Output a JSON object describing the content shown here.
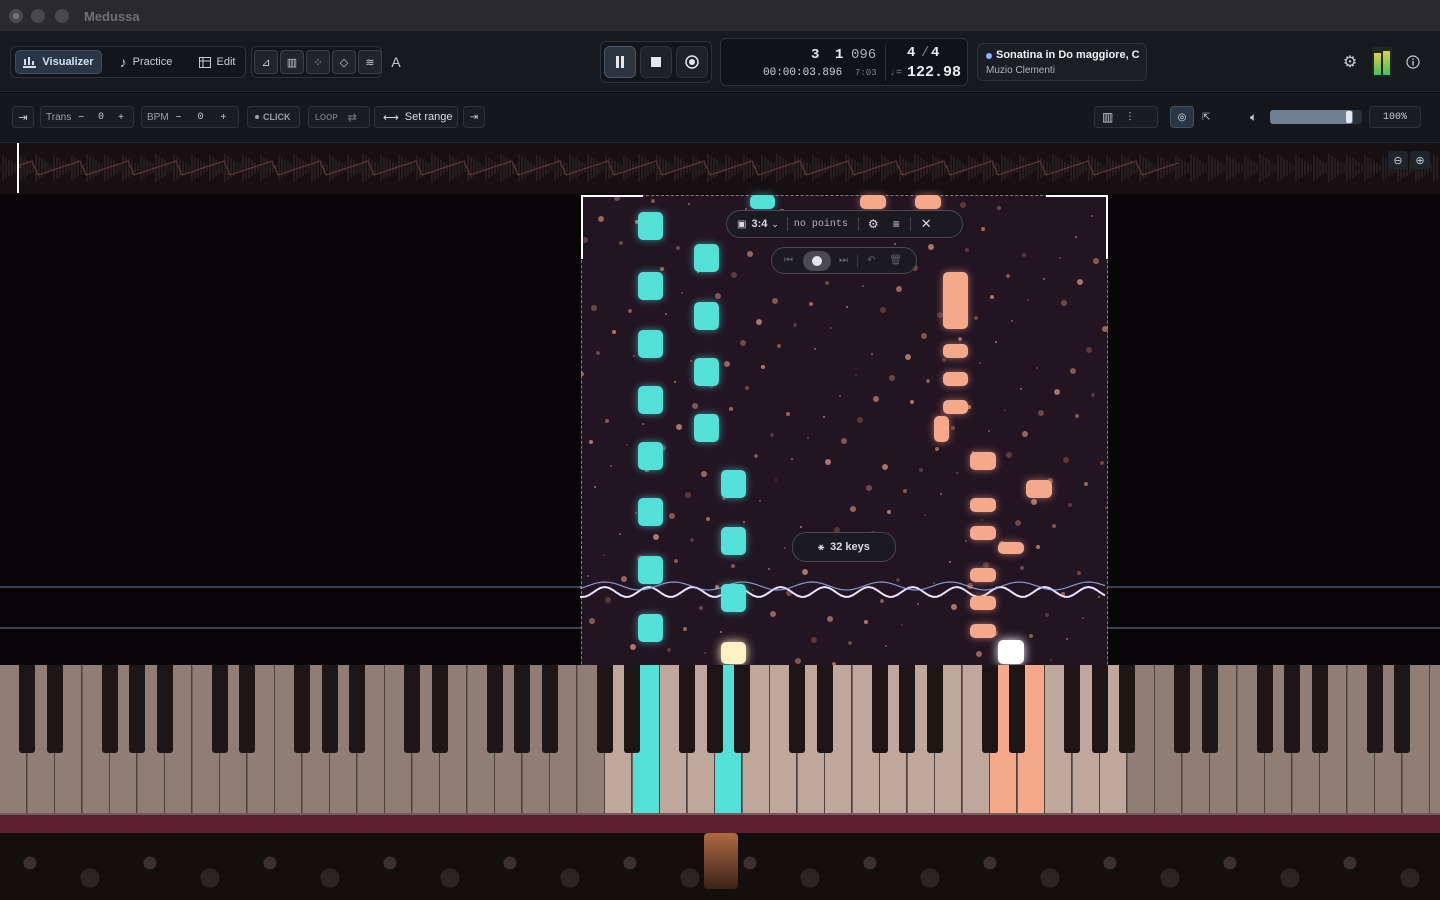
{
  "app": {
    "title": "Medussa"
  },
  "toolbar": {
    "modes": [
      {
        "label": "Visualizer"
      },
      {
        "label": "Practice"
      },
      {
        "label": "Edit"
      }
    ],
    "font_button": "A"
  },
  "position": {
    "bars": "3",
    "beats": "1",
    "ticks": "096",
    "time": "00:00:03.896",
    "duration": "7:03",
    "timesig_num": "4",
    "timesig_den": "4",
    "tempo_symbol": "♩=",
    "tempo": "122.98"
  },
  "song": {
    "title": "Sonatina in Do maggiore, C",
    "composer": "Muzio Clementi"
  },
  "controls": {
    "trans_label": "Trans",
    "trans_value": "0",
    "bpm_label": "BPM",
    "bpm_value": "0",
    "click_label": "CLICK",
    "loop_label": "LOOP",
    "set_range_label": "Set range",
    "zoom_value": "100%",
    "volume": 0.9
  },
  "capture": {
    "aspect": "3:4",
    "points": "no points"
  },
  "keys_badge": "32 keys",
  "colors": {
    "left_hand": "#53e0d8",
    "right_hand": "#f6a98a",
    "accent": "#3e5066"
  }
}
